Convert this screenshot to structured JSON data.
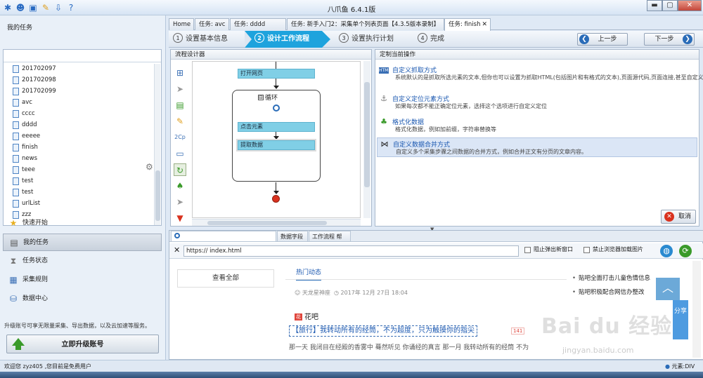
{
  "window": {
    "title": "八爪鱼 6.4.1版",
    "minimize": "▬",
    "maximize": "▢",
    "close": "✕"
  },
  "left": {
    "heading": "我的任务",
    "tasks": [
      "201702097",
      "201702098",
      "201702099",
      "avc",
      "cccc",
      "dddd",
      "eeeee",
      "finish",
      "news",
      "teee",
      "test",
      "test",
      "urlList",
      "zzz"
    ],
    "nav": [
      {
        "label": "快速开始",
        "icon": "star-icon"
      },
      {
        "label": "我的任务",
        "icon": "task-list-icon"
      },
      {
        "label": "任务状态",
        "icon": "hourglass-icon"
      },
      {
        "label": "采集规则",
        "icon": "rules-icon"
      },
      {
        "label": "数据中心",
        "icon": "database-icon"
      }
    ],
    "upgrade_text": "升级账号可享无限量采集、导出数据，以及云加速等服务。",
    "upgrade_button": "立即升级账号"
  },
  "tabs": [
    {
      "label": "Home"
    },
    {
      "label": "任务: avc"
    },
    {
      "label": "任务: dddd"
    },
    {
      "label": "任务: 新手入门2：采集单个列表页面【4.3.5版本录制】"
    },
    {
      "label": "任务: finish",
      "close": "✕"
    }
  ],
  "wizard": {
    "steps": [
      {
        "num": "1",
        "label": "设置基本信息"
      },
      {
        "num": "2",
        "label": "设计工作流程"
      },
      {
        "num": "3",
        "label": "设置执行计划"
      },
      {
        "num": "4",
        "label": "完成"
      }
    ],
    "prev": "上一步",
    "next": "下一步"
  },
  "designer": {
    "title": "流程设计器",
    "nodes": {
      "open_page": "打开网页",
      "loop": "循环",
      "loop_toggle": "⊟",
      "click": "点击元素",
      "extract": "提取数据"
    }
  },
  "ops": {
    "title": "定制当前操作",
    "items": [
      {
        "title": "自定义抓取方式",
        "desc": "系统默认的是抓取所选元素的文本,但你也可以设置为抓取HTML(包括图片和有格式的文本),页面源代码,页面连接,甚至自定义一个值.",
        "icon": "html-icon"
      },
      {
        "title": "自定义定位元素方式",
        "desc": "如果每次都不能正确定位元素，选择这个选项进行自定义定位",
        "icon": "anchor-icon"
      },
      {
        "title": "格式化数据",
        "desc": "格式化数据，例如加前缀，字符串替换等",
        "icon": "format-icon"
      },
      {
        "title": "自定义数据合并方式",
        "desc": "自定义多个采集步骤之间数据的合并方式，例如合并正文有分页的文章内容。",
        "icon": "merge-icon"
      }
    ],
    "cancel": "取消",
    "cancel_icon": "✕"
  },
  "browser": {
    "tabs": [
      "数据字段",
      "工作流程 帮助"
    ],
    "url": "https://              index.html",
    "block_popup": "阻止弹出新窗口",
    "block_images": "禁止浏览器加载图片",
    "page": {
      "view_all": "查看全部",
      "hot": "热门动态",
      "author": "天龙星神座",
      "date": "2017年 12月 27日 18:04",
      "bar_badge": "花",
      "bar": "花吧",
      "post": "【旅行】我转动所有的经筒，不为超度，只为触摸你的指尖",
      "post_count": "141",
      "snippet": "那一天 我闭目在经殿的香雾中 蓦然听见 你诵经的真言 那一月 我转动所有的经筒 不为",
      "side_links": [
        "贴吧全面打击儿童色情信息",
        "贴吧积极配合网信办整改"
      ],
      "share": "分享",
      "up": "︿"
    }
  },
  "status": {
    "welcome": "欢迎您  zyz405 ,您目前是免费用户",
    "element": "元素:DIV"
  },
  "watermark": {
    "logo": "Bai du 经验",
    "url": "jingyan.baidu.com"
  }
}
